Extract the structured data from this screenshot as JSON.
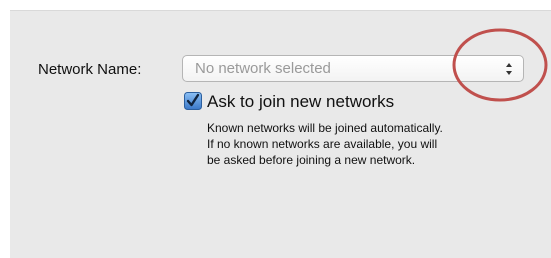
{
  "network": {
    "label": "Network Name:",
    "selected_value": "No network selected",
    "control_icon": "up-down-arrows-icon"
  },
  "ask_to_join": {
    "label": "Ask to join new networks",
    "checked": true,
    "description_lines": [
      "Known networks will be joined automatically.",
      "If no known networks are available, you will",
      "be asked before joining a new network."
    ]
  },
  "annotation": {
    "icon": "highlight-circle-icon",
    "color": "#c0504d"
  },
  "colors": {
    "panel_background": "#e9e9e9",
    "checkbox_blue": "#3a78c8"
  }
}
